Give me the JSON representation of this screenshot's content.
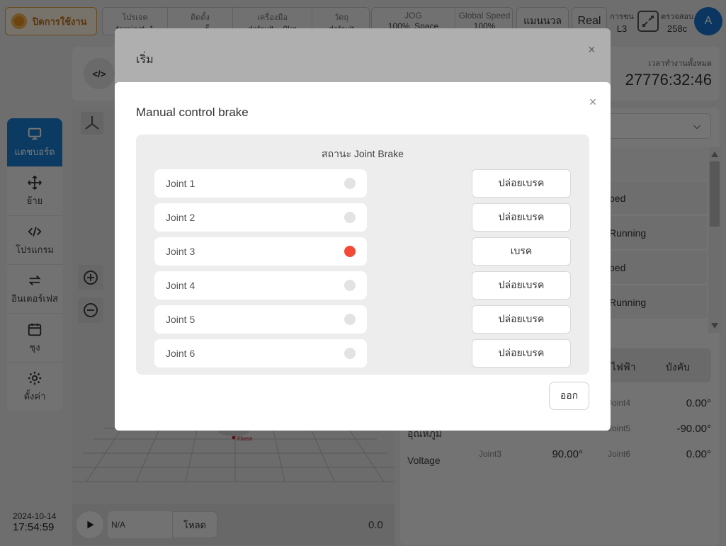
{
  "topbar": {
    "power_label": "ปิดการใช้งาน",
    "project": {
      "label": "โปรเจค",
      "value": "*project_1"
    },
    "install": {
      "label": "ติดตั้ง",
      "value": "แนวตั้ง"
    },
    "tool": {
      "label": "เครื่องมือ",
      "value": "default"
    },
    "payload": {
      "value": "0kg"
    },
    "object": {
      "label": "วัตถุ",
      "value": "default"
    },
    "jog": {
      "label": "JOG",
      "value": "100%",
      "mode": "Space"
    },
    "global_speed": {
      "label": "Global Speed",
      "value": "100%"
    },
    "manual_label": "แมนนวล",
    "real_label": "Real",
    "collision": {
      "label": "การชน",
      "value": "L3"
    },
    "check": {
      "label": "ตรวจสอบ",
      "value": "258c"
    },
    "avatar_letter": "A"
  },
  "header": {
    "code_icon": "</>",
    "runtime_label": "เวลาทำงานทั้งหมด",
    "runtime_value": "27776:32:46"
  },
  "sidenav": {
    "items": [
      {
        "label": "แดชบอร์ด",
        "icon": "monitor-icon"
      },
      {
        "label": "ย้าย",
        "icon": "move-icon"
      },
      {
        "label": "โปรแกรม",
        "icon": "code-icon"
      },
      {
        "label": "อินเตอร์เฟส",
        "icon": "interface-icon"
      },
      {
        "label": "ชุง",
        "icon": "calendar-icon"
      },
      {
        "label": "ตั้งค่า",
        "icon": "gear-icon"
      }
    ]
  },
  "viewport": {
    "axis_label": "Xbase",
    "program_placeholder": "N/A",
    "load_label": "โหลด",
    "progress_value": "0.0"
  },
  "datetime": {
    "date": "2024-10-14",
    "time": "17:54:59"
  },
  "rightpanel": {
    "status_rows": [
      "ped",
      "Running",
      "ped",
      "Running"
    ],
    "seg_left": "งไฟฟ้า",
    "seg_right": "บังคับ",
    "env_labels": [
      "อุณหภูมิ",
      "Voltage"
    ],
    "joints": [
      {
        "label": "Joint4",
        "value": "0.00°"
      },
      {
        "label": "Joint5",
        "value": "-90.00°"
      },
      {
        "label": "Joint3",
        "value": "90.00°"
      },
      {
        "label": "Joint6",
        "value": "0.00°"
      }
    ]
  },
  "under_dialog": {
    "title": "เริ่ม",
    "close": "×"
  },
  "modal": {
    "title": "Manual control brake",
    "close": "×",
    "panel_title": "สถานะ Joint Brake",
    "joints": [
      {
        "name": "Joint 1",
        "braked": false,
        "button": "ปล่อยเบรค"
      },
      {
        "name": "Joint 2",
        "braked": false,
        "button": "ปล่อยเบรค"
      },
      {
        "name": "Joint 3",
        "braked": true,
        "button": "เบรค"
      },
      {
        "name": "Joint 4",
        "braked": false,
        "button": "ปล่อยเบรค"
      },
      {
        "name": "Joint 5",
        "braked": false,
        "button": "ปล่อยเบรค"
      },
      {
        "name": "Joint 6",
        "braked": false,
        "button": "ปล่อยเบรค"
      }
    ],
    "exit_label": "ออก",
    "colors": {
      "braked": "#f24a36",
      "released": "#e3e3e3",
      "accent": "#1a7fd4"
    }
  }
}
